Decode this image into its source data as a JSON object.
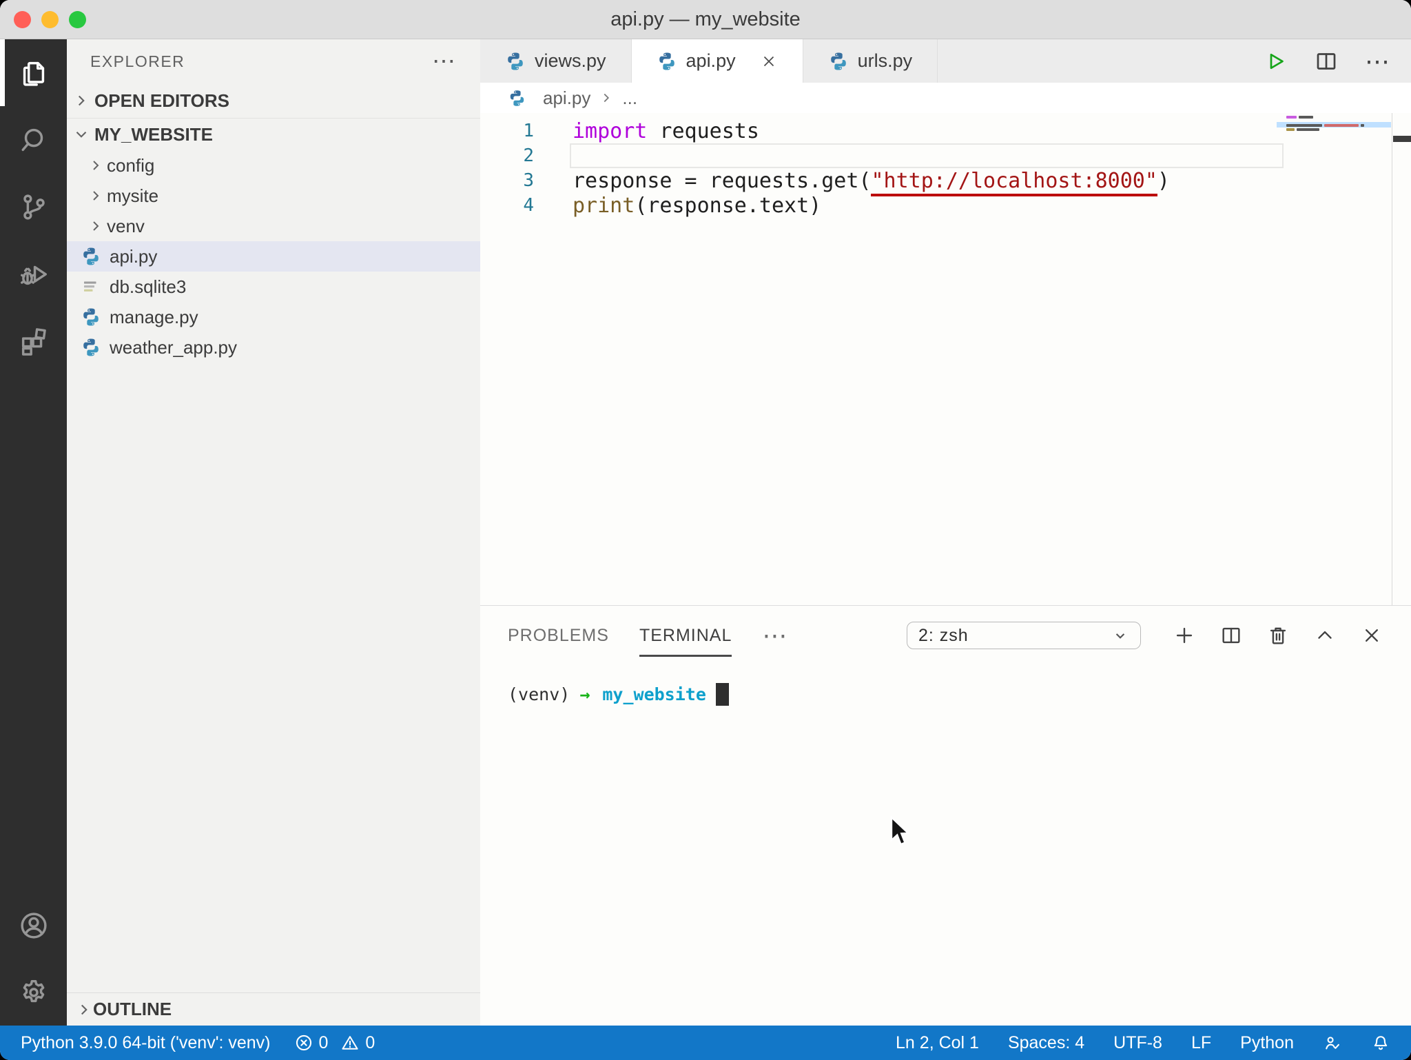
{
  "window": {
    "title": "api.py — my_website"
  },
  "colors": {
    "status_bar": "#1277C8",
    "selected_row_bg": "#E4E6F1",
    "keyword": "#AF00DB",
    "string": "#A31515",
    "string_underline": "#BC0D0D",
    "function": "#795E26",
    "terminal_cyan": "#0EA0CC",
    "terminal_green": "#19B419",
    "run_green": "#16A51A",
    "minimap_highlight": "#BFE0FF"
  },
  "sidebar": {
    "header": "EXPLORER",
    "open_editors": "OPEN EDITORS",
    "root": "MY_WEBSITE",
    "outline": "OUTLINE",
    "tree": [
      {
        "label": "config",
        "type": "folder"
      },
      {
        "label": "mysite",
        "type": "folder"
      },
      {
        "label": "venv",
        "type": "folder"
      },
      {
        "label": "api.py",
        "type": "python",
        "selected": true
      },
      {
        "label": "db.sqlite3",
        "type": "database"
      },
      {
        "label": "manage.py",
        "type": "python"
      },
      {
        "label": "weather_app.py",
        "type": "python"
      }
    ]
  },
  "tabs": [
    {
      "label": "views.py"
    },
    {
      "label": "api.py",
      "active": true
    },
    {
      "label": "urls.py"
    }
  ],
  "breadcrumb": {
    "file": "api.py",
    "more": "..."
  },
  "editor": {
    "lines": [
      {
        "num": "1",
        "t0": "import",
        "t1": " requests"
      },
      {
        "num": "2"
      },
      {
        "num": "3",
        "t0": "response = requests.get(",
        "t1": "\"http://localhost:8000\"",
        "t2": ")"
      },
      {
        "num": "4",
        "t0": "print",
        "t1": "(response.text)"
      }
    ]
  },
  "panel": {
    "problems": "PROBLEMS",
    "terminal": "TERMINAL",
    "shell": "2: zsh"
  },
  "terminal": {
    "venv": "(venv)",
    "arrow": "→",
    "cwd": "my_website"
  },
  "status_bar": {
    "interpreter": "Python 3.9.0 64-bit ('venv': venv)",
    "errors": "0",
    "warnings": "0",
    "cursor": "Ln 2, Col 1",
    "indent": "Spaces: 4",
    "encoding": "UTF-8",
    "eol": "LF",
    "language": "Python"
  }
}
